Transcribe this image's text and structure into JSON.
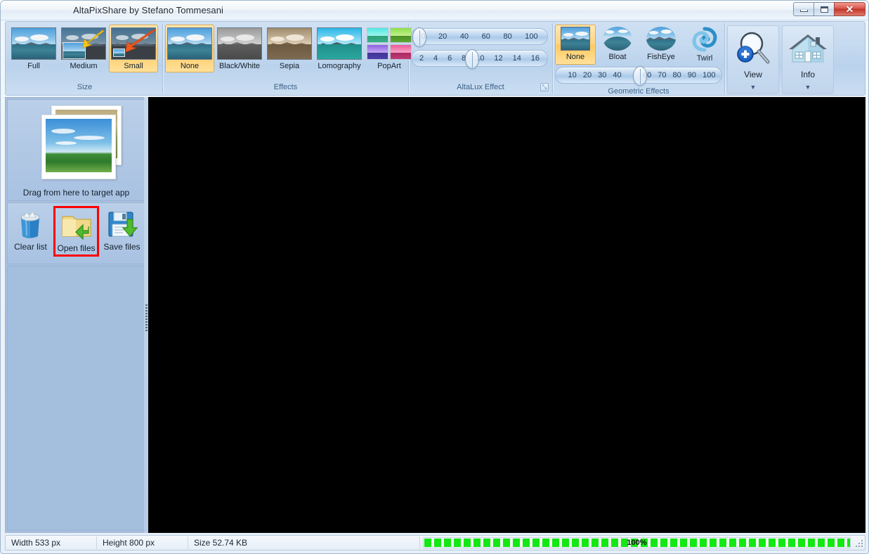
{
  "window": {
    "title": "AltaPixShare by Stefano Tommesani",
    "controls": {
      "minimize": "minimize-button",
      "maximize": "maximize-button",
      "close": "close-button",
      "close_glyph": "✕"
    }
  },
  "ribbon": {
    "groups": [
      {
        "name": "size",
        "label": "Size",
        "items": [
          {
            "label": "Full",
            "selected": false
          },
          {
            "label": "Medium",
            "selected": false
          },
          {
            "label": "Small",
            "selected": true
          }
        ]
      },
      {
        "name": "effects",
        "label": "Effects",
        "items": [
          {
            "label": "None",
            "selected": true
          },
          {
            "label": "Black/White",
            "selected": false
          },
          {
            "label": "Sepia",
            "selected": false
          },
          {
            "label": "Lomography",
            "selected": false
          },
          {
            "label": "PopArt",
            "selected": false
          }
        ]
      },
      {
        "name": "altalux",
        "label": "AltaLux Effect",
        "dialog_launcher": "⤡",
        "sliders": [
          {
            "name": "strength",
            "ticks": [
              "0",
              "20",
              "40",
              "60",
              "80",
              "100"
            ],
            "value": 0,
            "thumb_pct": 2
          },
          {
            "name": "scale",
            "ticks": [
              "2",
              "4",
              "6",
              "8",
              "10",
              "12",
              "14",
              "16"
            ],
            "value": 8,
            "thumb_pct": 44
          }
        ]
      },
      {
        "name": "geometric",
        "label": "Geometric Effects",
        "items": [
          {
            "label": "None",
            "selected": true
          },
          {
            "label": "Bloat",
            "selected": false
          },
          {
            "label": "FishEye",
            "selected": false
          },
          {
            "label": "Twirl",
            "selected": false
          }
        ],
        "slider": {
          "name": "amount",
          "ticks": [
            "",
            "10",
            "20",
            "30",
            "40",
            "50",
            "60",
            "70",
            "80",
            "90",
            "100"
          ],
          "value": 50,
          "thumb_pct": 50
        }
      },
      {
        "name": "view",
        "buttons": [
          {
            "label": "View",
            "icon": "magnifier-plus-icon",
            "caret": "▼"
          },
          {
            "label": "Info",
            "icon": "house-icon",
            "caret": "▼"
          }
        ]
      }
    ]
  },
  "sidebar": {
    "drag_caption": "Drag from here to target app",
    "file_buttons": [
      {
        "label": "Clear list",
        "icon": "trash-bin-icon",
        "highlighted": false
      },
      {
        "label": "Open files",
        "icon": "open-folder-icon",
        "highlighted": true
      },
      {
        "label": "Save files",
        "icon": "floppy-save-icon",
        "highlighted": false
      }
    ]
  },
  "statusbar": {
    "width": "Width 533 px",
    "height": "Height 800 px",
    "size": "Size 52.74 KB",
    "progress_text": "100%",
    "progress_value": 100
  },
  "colors": {
    "accent": "#ffc95f",
    "highlight_border": "#ff0000",
    "progress": "#14e814",
    "canvas": "#000000"
  }
}
